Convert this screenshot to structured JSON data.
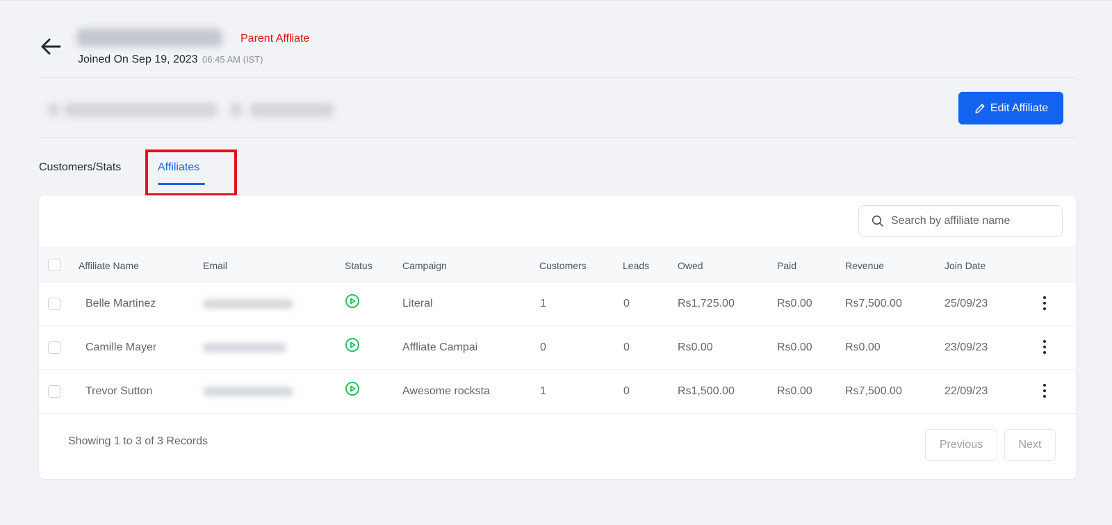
{
  "header": {
    "parent_label": "Parent Affliate",
    "joined_label": "Joined On Sep 19, 2023",
    "joined_time": "06:45 AM (IST)",
    "edit_button": "Edit Affiliate"
  },
  "tabs": [
    {
      "label": "Customers/Stats",
      "active": false
    },
    {
      "label": "Affiliates",
      "active": true
    }
  ],
  "search": {
    "placeholder": "Search by affiliate name"
  },
  "table": {
    "columns": [
      "Affiliate Name",
      "Email",
      "Status",
      "Campaign",
      "Customers",
      "Leads",
      "Owed",
      "Paid",
      "Revenue",
      "Join Date"
    ],
    "rows": [
      {
        "name": "Belle Martinez",
        "status": "active",
        "campaign": "Literal",
        "customers": "1",
        "leads": "0",
        "owed": "Rs1,725.00",
        "paid": "Rs0.00",
        "revenue": "Rs7,500.00",
        "join_date": "25/09/23"
      },
      {
        "name": "Camille Mayer",
        "status": "active",
        "campaign": "Affliate Campai",
        "customers": "0",
        "leads": "0",
        "owed": "Rs0.00",
        "paid": "Rs0.00",
        "revenue": "Rs0.00",
        "join_date": "23/09/23"
      },
      {
        "name": "Trevor Sutton",
        "status": "active",
        "campaign": "Awesome rocksta",
        "customers": "1",
        "leads": "0",
        "owed": "Rs1,500.00",
        "paid": "Rs0.00",
        "revenue": "Rs7,500.00",
        "join_date": "22/09/23"
      }
    ]
  },
  "footer": {
    "records_text": "Showing 1 to 3 of 3 Records",
    "previous": "Previous",
    "next": "Next"
  },
  "colors": {
    "accent": "#1463f0",
    "parent_label": "#e0101a",
    "status_active": "#22c55e",
    "highlight_box": "#e8101b"
  },
  "icons": {
    "back": "arrow-left-icon",
    "edit": "pencil-icon",
    "search": "search-icon",
    "status": "play-circle-icon",
    "row_menu": "more-vertical-icon"
  }
}
